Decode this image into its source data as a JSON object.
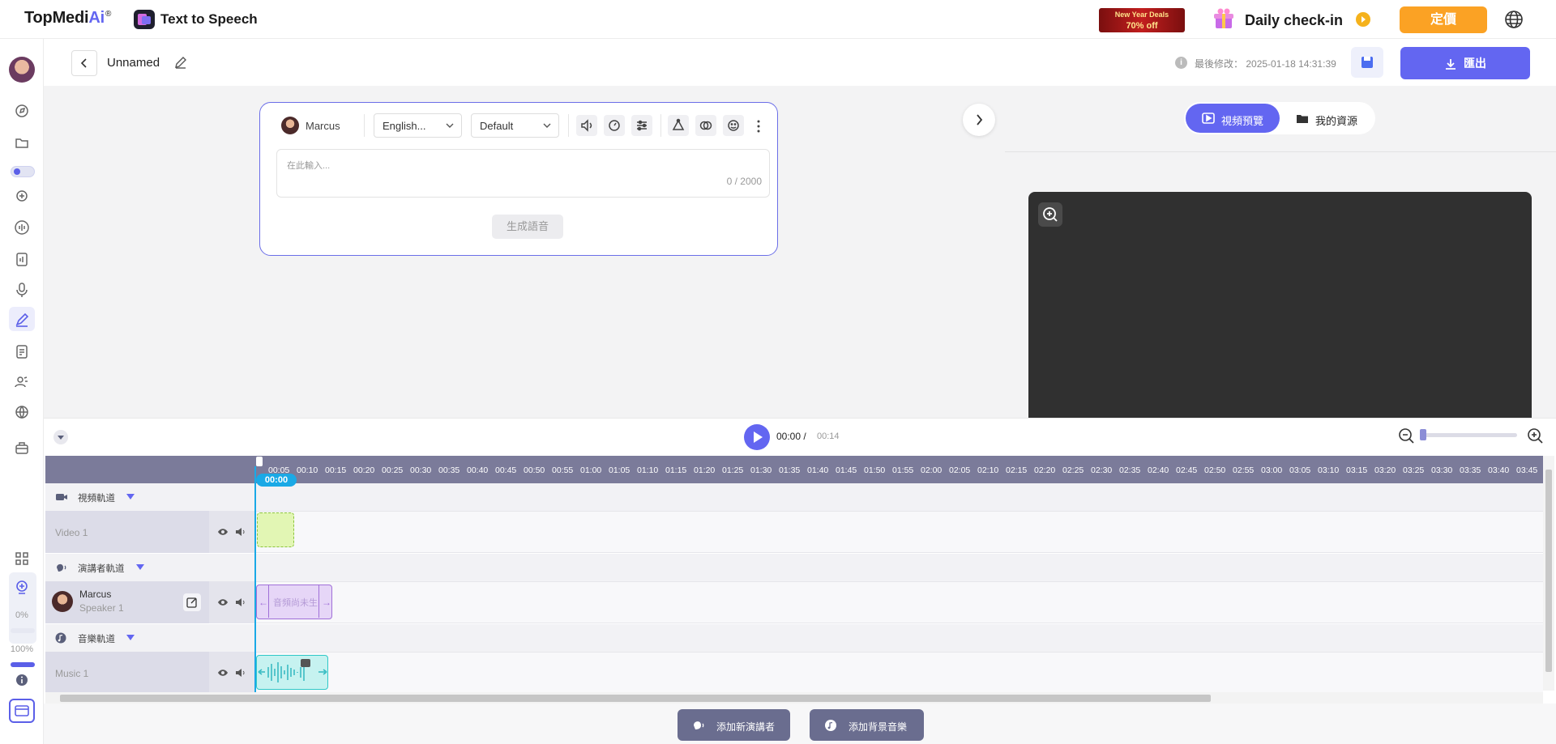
{
  "topbar": {
    "logo_main": "TopMedi",
    "logo_ai": "Ai",
    "logo_reg": "®",
    "app_name": "Text to Speech",
    "promo_line1": "New Year Deals",
    "promo_line2": "70% off",
    "daily_checkin": "Daily check-in",
    "pricing_label": "定價",
    "icons": [
      "app-icon",
      "gift-icon",
      "play-arrow-icon",
      "globe-icon"
    ]
  },
  "header": {
    "project_name": "Unnamed",
    "modified_label": "最後修改：",
    "modified_time": "2025-01-18 14:31:39",
    "info_glyph": "i",
    "export_label": "匯出"
  },
  "editor": {
    "speaker_name": "Marcus",
    "language": "English...",
    "voice_style": "Default",
    "placeholder": "在此輸入...",
    "char_count": "0 / 2000",
    "generate_label": "生成語音"
  },
  "preview": {
    "tab_preview": "視頻預覽",
    "tab_resources": "我的資源"
  },
  "playback": {
    "current_time": "00:00 /",
    "total_time": "00:14",
    "zoom_level": 0.0
  },
  "timeline": {
    "playhead_label": "00:00",
    "ruler_ticks": [
      "00:05",
      "00:10",
      "00:15",
      "00:20",
      "00:25",
      "00:30",
      "00:35",
      "00:40",
      "00:45",
      "00:50",
      "00:55",
      "01:00",
      "01:05",
      "01:10",
      "01:15",
      "01:20",
      "01:25",
      "01:30",
      "01:35",
      "01:40",
      "01:45",
      "01:50",
      "01:55",
      "02:00",
      "02:05",
      "02:10",
      "02:15",
      "02:20",
      "02:25",
      "02:30",
      "02:35",
      "02:40",
      "02:45",
      "02:50",
      "02:55",
      "03:00",
      "03:05",
      "03:10",
      "03:15",
      "03:20",
      "03:25",
      "03:30",
      "03:35",
      "03:40",
      "03:45"
    ],
    "video_group": "視頻軌道",
    "video_track": "Video 1",
    "speaker_group": "演講者軌道",
    "speaker_track_name": "Marcus",
    "speaker_track_sub": "Speaker 1",
    "speech_clip_text": "音頻尚未生",
    "music_group": "音樂軌道",
    "music_track": "Music 1"
  },
  "sidebar": {
    "progress_start": "0%",
    "progress_end": "100%"
  },
  "bottom": {
    "add_speaker": "添加新演講者",
    "add_music": "添加背景音樂"
  },
  "colors": {
    "accent": "#6366f1",
    "pricing": "#fba224",
    "playhead": "#1aa9e6",
    "ruler": "#7b7b9a"
  }
}
